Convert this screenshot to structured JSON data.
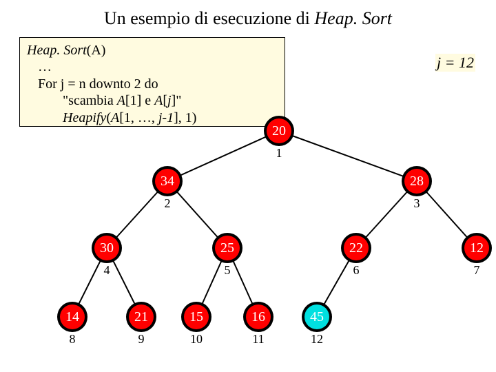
{
  "title": {
    "prefix": "Un esempio di esecuzione di ",
    "ital": "Heap. Sort"
  },
  "code": {
    "l1a": "Heap. Sort",
    "l1b": "(A)",
    "l2": "…",
    "l3": "For j  = n downto 2 do",
    "l4a": "\"scambia ",
    "l4b": "A",
    "l4c": "[1] e ",
    "l4d": "A",
    "l4e": "[",
    "l4f": "j",
    "l4g": "]\"",
    "l5a": "Heapify",
    "l5b": "(",
    "l5c": "A",
    "l5d": "[1, …, ",
    "l5e": "j-1",
    "l5f": "], 1)"
  },
  "jvar": "j = 12",
  "nodes": {
    "n1": {
      "val": "20",
      "idx": "1"
    },
    "n2": {
      "val": "34",
      "idx": "2"
    },
    "n3": {
      "val": "28",
      "idx": "3"
    },
    "n4": {
      "val": "30",
      "idx": "4"
    },
    "n5": {
      "val": "25",
      "idx": "5"
    },
    "n6": {
      "val": "22",
      "idx": "6"
    },
    "n7": {
      "val": "12",
      "idx": "7"
    },
    "n8": {
      "val": "14",
      "idx": "8"
    },
    "n9": {
      "val": "21",
      "idx": "9"
    },
    "n10": {
      "val": "15",
      "idx": "10"
    },
    "n11": {
      "val": "16",
      "idx": "11"
    },
    "n12": {
      "val": "45",
      "idx": "12"
    }
  },
  "chart_data": {
    "type": "tree",
    "title": "Un esempio di esecuzione di Heap.Sort",
    "annotation": "j = 12",
    "nodes": [
      {
        "id": 1,
        "value": 20,
        "children": [
          2,
          3
        ]
      },
      {
        "id": 2,
        "value": 34,
        "children": [
          4,
          5
        ]
      },
      {
        "id": 3,
        "value": 28,
        "children": [
          6,
          7
        ]
      },
      {
        "id": 4,
        "value": 30,
        "children": [
          8,
          9
        ]
      },
      {
        "id": 5,
        "value": 25,
        "children": [
          10,
          11
        ]
      },
      {
        "id": 6,
        "value": 22,
        "children": [
          12
        ]
      },
      {
        "id": 7,
        "value": 12,
        "children": []
      },
      {
        "id": 8,
        "value": 14,
        "children": []
      },
      {
        "id": 9,
        "value": 21,
        "children": []
      },
      {
        "id": 10,
        "value": 15,
        "children": []
      },
      {
        "id": 11,
        "value": 16,
        "children": []
      },
      {
        "id": 12,
        "value": 45,
        "children": [],
        "highlighted": true
      }
    ]
  }
}
